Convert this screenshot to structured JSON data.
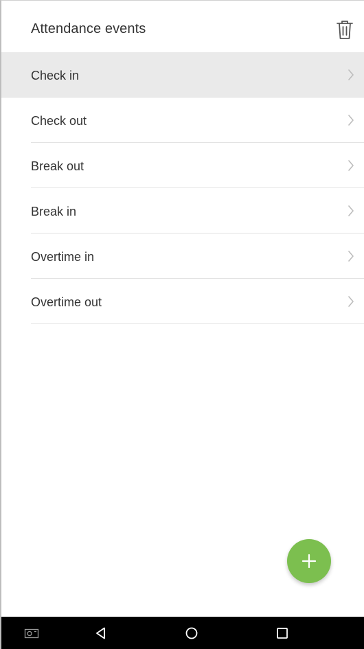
{
  "header": {
    "title": "Attendance events",
    "delete_icon": "trash-icon"
  },
  "events": {
    "items": [
      {
        "label": "Check in",
        "selected": true
      },
      {
        "label": "Check out",
        "selected": false
      },
      {
        "label": "Break out",
        "selected": false
      },
      {
        "label": "Break in",
        "selected": false
      },
      {
        "label": "Overtime in",
        "selected": false
      },
      {
        "label": "Overtime out",
        "selected": false
      }
    ],
    "row_icon": "chevron-right-icon"
  },
  "fab": {
    "icon": "plus-icon",
    "color": "#7cbf4f"
  },
  "system_nav": {
    "buttons": [
      "screenshot-icon",
      "back-icon",
      "home-icon",
      "recents-icon"
    ],
    "background": "#000000"
  },
  "colors": {
    "selected_row": "#eaeaea",
    "text": "#333333",
    "divider": "#e3e3e3"
  }
}
